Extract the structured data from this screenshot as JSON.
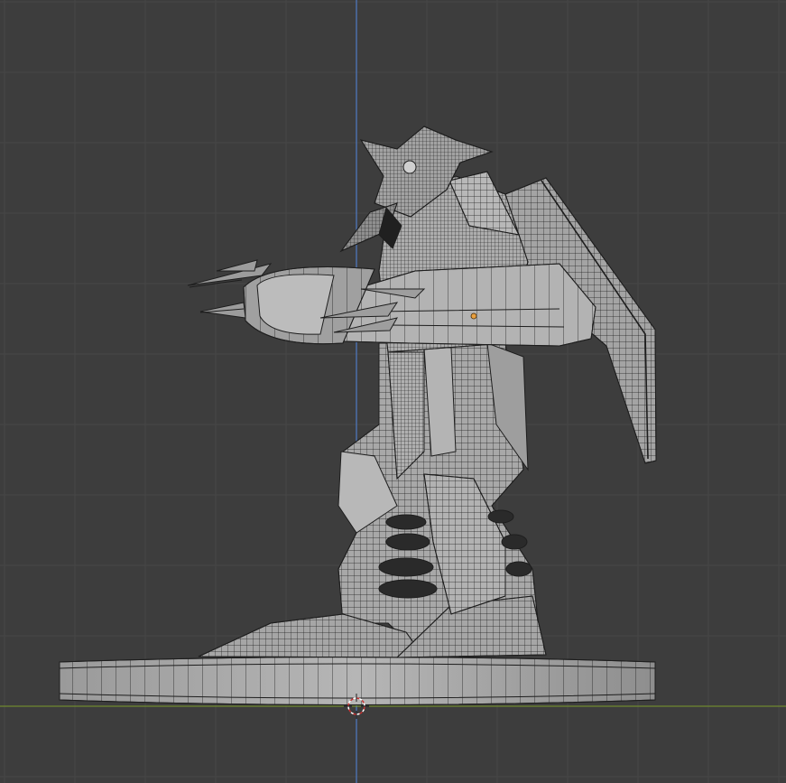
{
  "viewport": {
    "view": "orthographic-side",
    "shading": "solid-wireframe-overlay",
    "colors": {
      "background": "#3d3d3d",
      "grid_minor": "#474747",
      "grid_major": "#333333",
      "axis_z": "#4f7bc4",
      "axis_y": "#7a9a2a",
      "mesh_fill": "#a9a9a9",
      "mesh_wire": "#1e1e1e",
      "cursor": "#c83232"
    }
  },
  "scene": {
    "object": "armored-knight-figure-on-round-base",
    "origin_icon": "object-origin-dot-icon",
    "cursor_icon": "3d-cursor-icon"
  }
}
